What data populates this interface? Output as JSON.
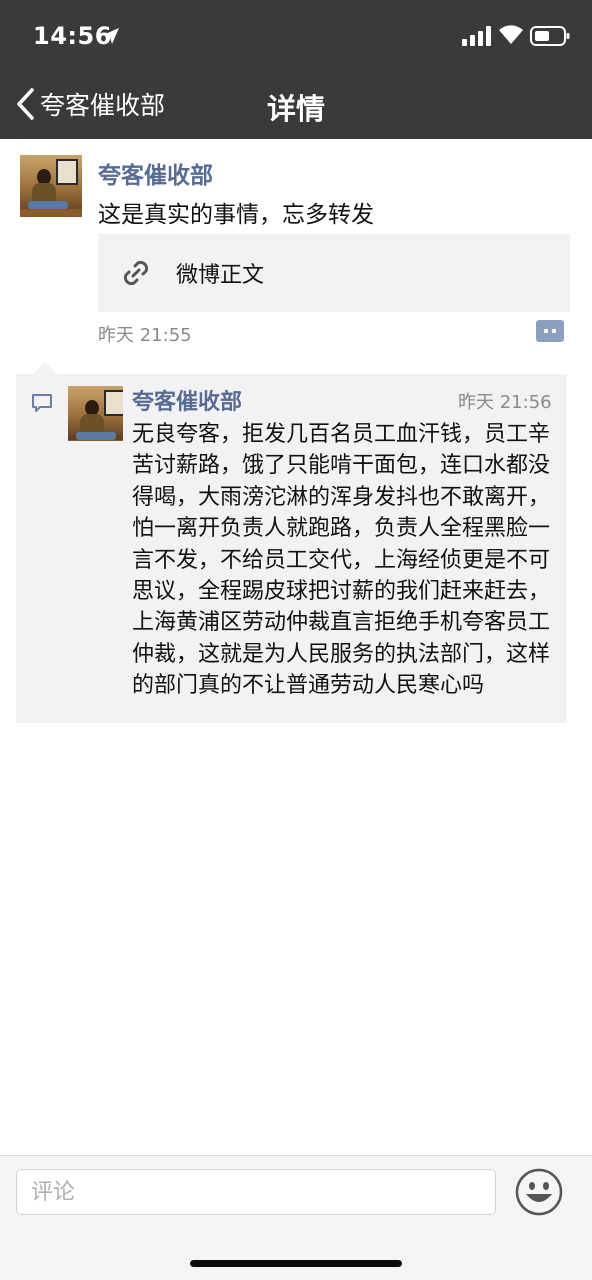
{
  "status_bar": {
    "time": "14:56"
  },
  "nav": {
    "back_label": "夸客催收部",
    "title": "详情"
  },
  "post": {
    "author": "夸客催收部",
    "text": "这是真实的事情，忘多转发",
    "link_label": "微博正文",
    "time": "昨天 21:55"
  },
  "comment": {
    "author": "夸客催收部",
    "time": "昨天 21:56",
    "text": "无良夸客，拒发几百名员工血汗钱，员工辛苦讨薪路，饿了只能啃干面包，连口水都没得喝，大雨滂沱淋的浑身发抖也不敢离开，怕一离开负责人就跑路，负责人全程黑脸一言不发，不给员工交代，上海经侦更是不可思议，全程踢皮球把讨薪的我们赶来赶去，上海黄浦区劳动仲裁直言拒绝手机夸客员工仲裁，这就是为人民服务的执法部门，这样的部门真的不让普通劳动人民寒心吗"
  },
  "comment_bar": {
    "placeholder": "评论"
  },
  "colors": {
    "header_bg": "#3a3a3d",
    "name_link": "#576b95",
    "panel_bg": "#f2f2f4"
  }
}
